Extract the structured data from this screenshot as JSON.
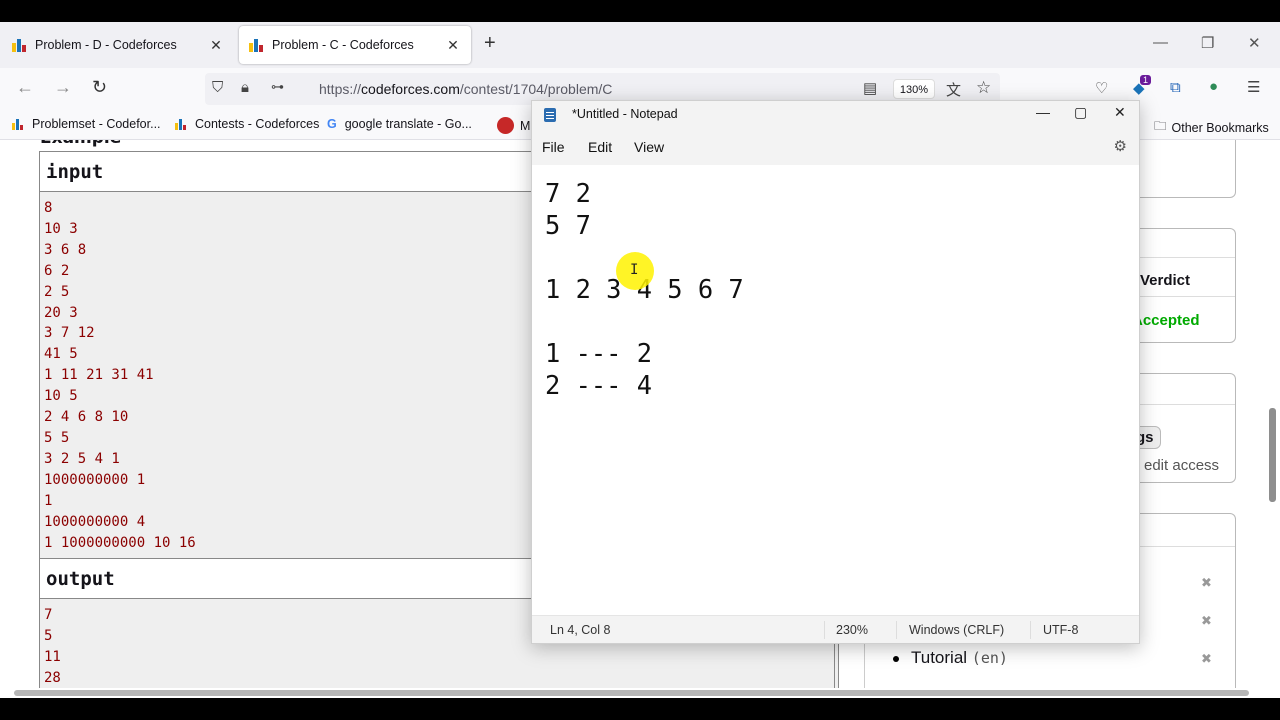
{
  "browser": {
    "tabs": [
      {
        "title": "Problem - D - Codeforces",
        "active": false
      },
      {
        "title": "Problem - C - Codeforces",
        "active": true
      }
    ],
    "new_tab": "+",
    "window_controls": {
      "minimize": "—",
      "restore": "❐",
      "close": "✕"
    },
    "nav": {
      "back": "←",
      "forward": "→",
      "reload": "↻"
    },
    "url_prefix": "https://",
    "url_domain": "codeforces.com",
    "url_path": "/contest/1704/problem/C",
    "zoom": "130%",
    "extension_badge": "1",
    "bookmarks": [
      {
        "label": "Problemset - Codefor..."
      },
      {
        "label": "Contests - Codeforces"
      },
      {
        "label": "google translate - Go..."
      },
      {
        "label": "M"
      }
    ],
    "other_bookmarks": "Other Bookmarks",
    "icons": [
      "shield-icon",
      "lock-icon",
      "permissions-icon",
      "reader-icon",
      "translate-icon",
      "star-icon",
      "pocket-icon",
      "extension-icon",
      "translator-icon",
      "vpn-icon",
      "menu-icon"
    ]
  },
  "page": {
    "example_heading": "Example",
    "input_label": "input",
    "input_lines": "8\n10 3\n3 6 8\n6 2\n2 5\n20 3\n3 7 12\n41 5\n1 11 21 31 41\n10 5\n2 4 6 8 10\n5 5\n3 2 5 4 1\n1000000000 1\n1\n1000000000 4\n1 1000000000 10 16",
    "output_label": "output",
    "output_lines": "7\n5\n11\n28",
    "sidebar": {
      "verdict_label": "Verdict",
      "verdict_value": "Accepted",
      "tags_button": "gs",
      "edit_access": "edit access",
      "close_x": "✖",
      "tutorial_label": "Tutorial",
      "tutorial_lang": "(en)"
    }
  },
  "notepad": {
    "title": "*Untitled - Notepad",
    "menu": [
      "File",
      "Edit",
      "View"
    ],
    "controls": {
      "minimize": "—",
      "maximize": "▢",
      "close": "✕"
    },
    "content": "7 2\n5 7\n\n1 2 3 4 5 6 7\n\n1 --- 2\n2 --- 4",
    "status": {
      "position": "Ln 4, Col 8",
      "zoom": "230%",
      "line_endings": "Windows (CRLF)",
      "encoding": "UTF-8"
    }
  },
  "colors": {
    "accepted": "#0a0",
    "sample_text": "#8b0000",
    "cursor_highlight": "#fff200"
  }
}
